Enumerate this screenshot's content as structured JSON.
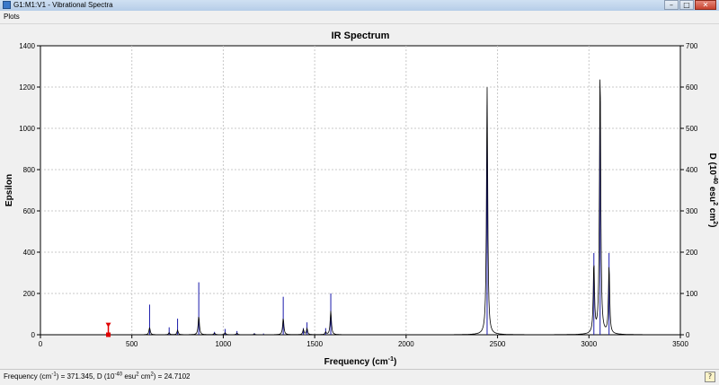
{
  "window": {
    "title": "G1:M1:V1 - Vibrational Spectra",
    "minimize_glyph": "–",
    "maximize_glyph": "□",
    "close_glyph": "✕"
  },
  "menu": {
    "plots_label": "Plots"
  },
  "status": {
    "freq_label": "Frequency (cm",
    "freq_exp": "-1",
    "freq_value": ") = 371.345, D (10",
    "d_exp": "-40",
    "d_unit": " esu",
    "d_unit_exp": "2",
    "d_tail": " cm",
    "d_tail_exp": "2",
    "d_value": ") = 24.7102",
    "help_glyph": "?"
  },
  "colors": {
    "stick": "#1a1aaa",
    "curve": "#000000",
    "marker": "#e00000",
    "grid": "#c8c8c8"
  },
  "chart_data": {
    "type": "line",
    "title": "IR Spectrum",
    "xlabel": "Frequency (cm-1)",
    "ylabel": "Epsilon",
    "y2label": "D (10-40 esu2 cm2)",
    "xlim": [
      0,
      3500
    ],
    "ylim": [
      0,
      1400
    ],
    "y2lim": [
      0,
      700
    ],
    "xticks": [
      0,
      500,
      1000,
      1500,
      2000,
      2500,
      3000,
      3500
    ],
    "yticks": [
      0,
      200,
      400,
      600,
      800,
      1000,
      1200,
      1400
    ],
    "y2ticks": [
      0,
      100,
      200,
      300,
      400,
      500,
      600,
      700
    ],
    "grid": true,
    "cursor": {
      "x": 371.345,
      "D": 24.7102
    },
    "series": [
      {
        "kind": "epsilon_curve",
        "peaks": [
          [
            597,
            35
          ],
          [
            704,
            10
          ],
          [
            750,
            22
          ],
          [
            866,
            90
          ],
          [
            952,
            8
          ],
          [
            1010,
            10
          ],
          [
            1075,
            8
          ],
          [
            1170,
            4
          ],
          [
            1328,
            80
          ],
          [
            1438,
            25
          ],
          [
            1458,
            30
          ],
          [
            1560,
            12
          ],
          [
            1588,
            115
          ],
          [
            2443,
            1200
          ],
          [
            3027,
            340
          ],
          [
            3061,
            1300
          ],
          [
            3110,
            330
          ]
        ]
      },
      {
        "kind": "D_sticks",
        "sticks": [
          [
            597,
            73
          ],
          [
            704,
            18
          ],
          [
            750,
            39
          ],
          [
            866,
            127
          ],
          [
            952,
            7
          ],
          [
            1010,
            14
          ],
          [
            1075,
            9
          ],
          [
            1170,
            4
          ],
          [
            1220,
            3
          ],
          [
            1328,
            92
          ],
          [
            1438,
            16
          ],
          [
            1458,
            30
          ],
          [
            1560,
            16
          ],
          [
            1588,
            100
          ],
          [
            2443,
            557
          ],
          [
            3027,
            198
          ],
          [
            3061,
            565
          ],
          [
            3110,
            198
          ]
        ]
      }
    ]
  }
}
